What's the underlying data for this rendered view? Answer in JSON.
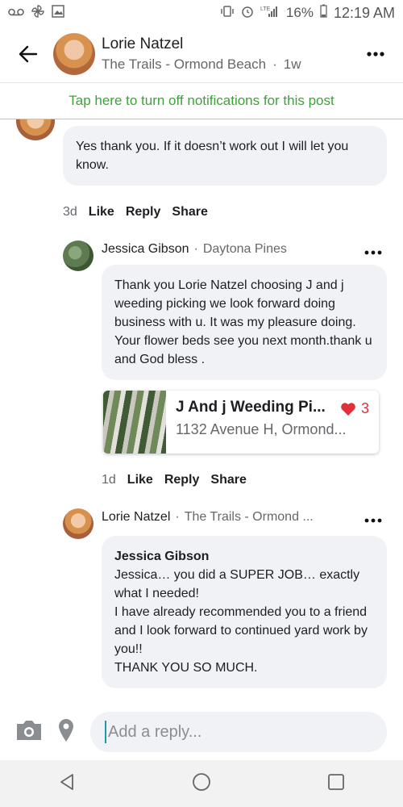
{
  "status": {
    "battery": "16%",
    "time": "12:19 AM",
    "network": "LTE"
  },
  "header": {
    "name": "Lorie Natzel",
    "location": "The Trails - Ormond Beach",
    "dot": "·",
    "age": "1w"
  },
  "notification_bar": "Tap here to turn off notifications for this post",
  "comment1": {
    "text": "Yes thank you.  If it doesn’t work out I will let you know.",
    "time": "3d",
    "like": "Like",
    "reply": "Reply",
    "share": "Share"
  },
  "comment2": {
    "author": "Jessica Gibson",
    "sep": "·",
    "location": "Daytona Pines",
    "text": "Thank you Lorie Natzel choosing J and j weeding picking we look forward doing business with u. It was my pleasure doing. Your flower beds see you next month.thank u and God bless .",
    "card": {
      "title": "J And j Weeding Pi...",
      "address": "1132 Avenue H, Ormond...",
      "hearts": "3"
    },
    "time": "1d",
    "like": "Like",
    "reply": "Reply",
    "share": "Share"
  },
  "comment3": {
    "author": "Lorie Natzel",
    "sep": "·",
    "location": "The Trails - Ormond ...",
    "mention": "Jessica Gibson",
    "lines": [
      "Jessica… you did a SUPER JOB… exactly what I needed!",
      "I have already recommended you to a friend and I look forward to continued yard work by you!!",
      "THANK YOU SO MUCH."
    ]
  },
  "composer": {
    "placeholder": "Add a reply..."
  },
  "colors": {
    "accent_green": "#3ba436",
    "heart": "#e0303b",
    "bubble": "#f0f2f5",
    "caret": "#1a9ba5"
  }
}
